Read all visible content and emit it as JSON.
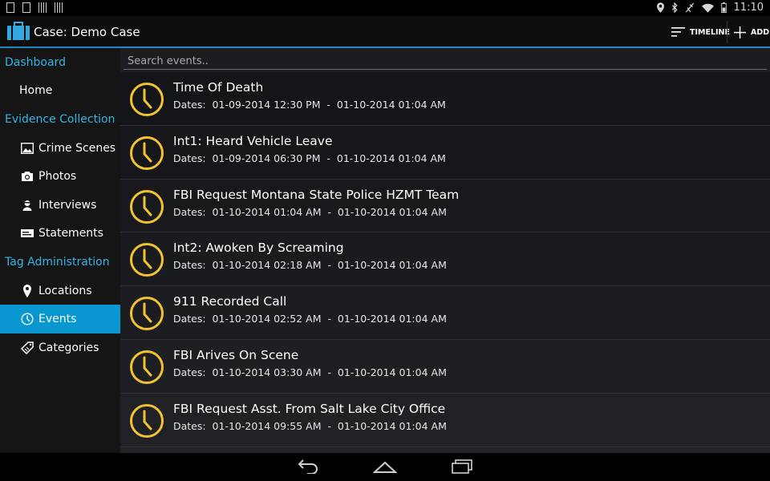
{
  "status_bar": {
    "time": "11:10",
    "left_icons": [
      "notification-icon",
      "image-icon",
      "barcode-icon",
      "barcode-icon"
    ],
    "right_icons": [
      "location-icon",
      "bluetooth-icon",
      "signal-off-icon",
      "wifi-icon",
      "battery-icon"
    ]
  },
  "action_bar": {
    "title": "Case: Demo Case",
    "timeline_label": "TIMELINE",
    "add_label": "ADD"
  },
  "sidebar": {
    "sections": [
      {
        "label": "Dashboard",
        "items": [
          {
            "label": "Home",
            "icon": ""
          }
        ]
      },
      {
        "label": "Evidence Collection",
        "items": [
          {
            "label": "Crime Scenes",
            "icon": "landscape-icon"
          },
          {
            "label": "Photos",
            "icon": "camera-icon"
          },
          {
            "label": "Interviews",
            "icon": "person-icon"
          },
          {
            "label": "Statements",
            "icon": "card-icon"
          }
        ]
      },
      {
        "label": "Tag Administration",
        "items": [
          {
            "label": "Locations",
            "icon": "location-pin-icon"
          },
          {
            "label": "Events",
            "icon": "clock-icon",
            "active": true
          },
          {
            "label": "Categories",
            "icon": "tag-icon"
          }
        ]
      }
    ]
  },
  "search": {
    "placeholder": "Search events.."
  },
  "events": [
    {
      "title": "Time Of Death",
      "dates": "Dates:  01-09-2014 12:30 PM  -  01-10-2014 01:04 AM"
    },
    {
      "title": "Int1: Heard Vehicle Leave",
      "dates": "Dates:  01-09-2014 06:30 PM  -  01-10-2014 01:04 AM"
    },
    {
      "title": "FBI Request Montana State Police HZMT Team",
      "dates": "Dates:  01-10-2014 01:04 AM  -  01-10-2014 01:04 AM"
    },
    {
      "title": "Int2: Awoken By Screaming",
      "dates": "Dates:  01-10-2014 02:18 AM  -  01-10-2014 01:04 AM"
    },
    {
      "title": "911 Recorded Call",
      "dates": "Dates:  01-10-2014 02:52 AM  -  01-10-2014 01:04 AM"
    },
    {
      "title": "FBI Arives On Scene",
      "dates": "Dates:  01-10-2014 03:30 AM  -  01-10-2014 01:04 AM"
    },
    {
      "title": "FBI Request Asst. From Salt Lake City Office",
      "dates": "Dates:  01-10-2014 09:55 AM  -  01-10-2014 01:04 AM"
    }
  ],
  "colors": {
    "accent": "#33b5e5",
    "active_item": "#0a97d0",
    "clock_icon": "#f2c230",
    "action_bar_underline": "#1e87c7"
  }
}
